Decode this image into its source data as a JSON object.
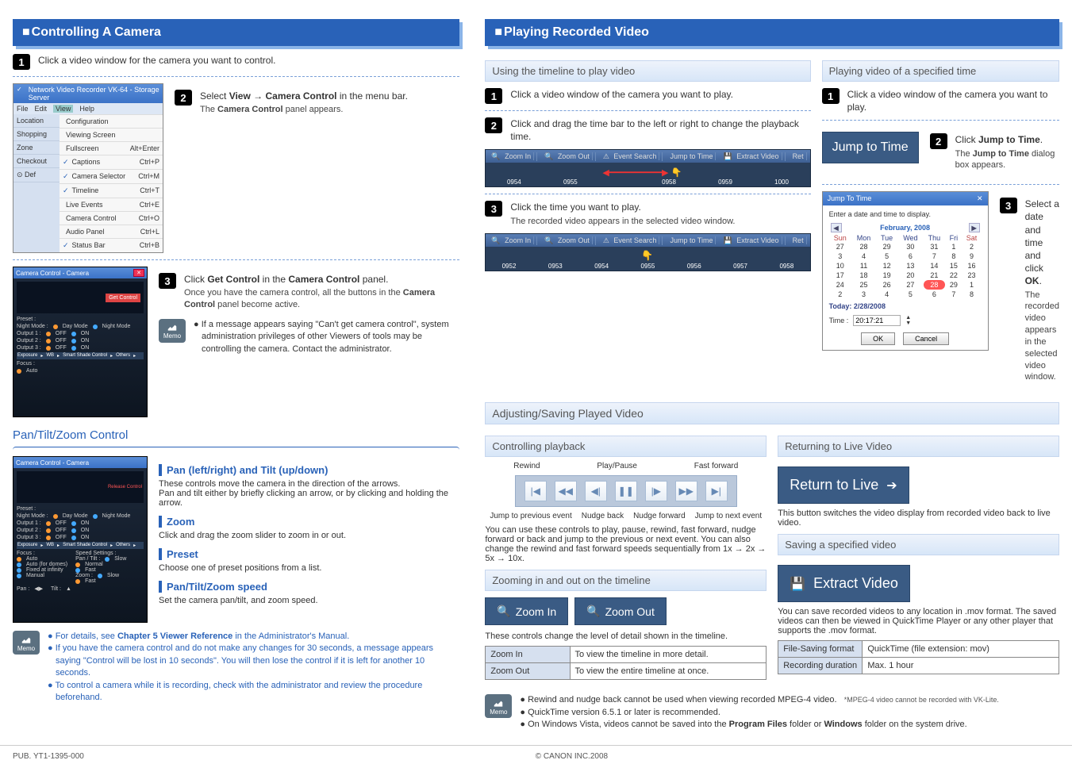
{
  "left": {
    "heading": "Controlling A Camera",
    "step1": "Click a video window for the camera you want to control.",
    "step2_a": "Select ",
    "step2_b": "View",
    "step2_c": " → ",
    "step2_d": "Camera Control",
    "step2_e": " in the menu bar.",
    "step2_sub_a": "The ",
    "step2_sub_b": "Camera Control",
    "step2_sub_c": " panel appears.",
    "step3_a": "Click ",
    "step3_b": "Get Control",
    "step3_c": " in the ",
    "step3_d": "Camera Control",
    "step3_e": " panel.",
    "step3_sub_a": "Once you have the camera control, all the buttons in the ",
    "step3_sub_b": "Camera Control",
    "step3_sub_c": " panel become active.",
    "menu": {
      "title": "Network Video Recorder VK-64 - Storage Server",
      "bar": [
        "File",
        "Edit",
        "View",
        "Help"
      ],
      "side": [
        "Location",
        "Shopping",
        "Zone",
        "Checkout",
        "Def"
      ],
      "items": [
        {
          "chk": "",
          "label": "Configuration",
          "sc": ""
        },
        {
          "chk": "",
          "label": "Viewing Screen",
          "sc": ""
        },
        {
          "chk": "",
          "label": "Fullscreen",
          "sc": "Alt+Enter"
        },
        {
          "chk": "✓",
          "label": "Captions",
          "sc": "Ctrl+P"
        },
        {
          "chk": "✓",
          "label": "Camera Selector",
          "sc": "Ctrl+M"
        },
        {
          "chk": "✓",
          "label": "Timeline",
          "sc": "Ctrl+T"
        },
        {
          "chk": "",
          "label": "Live Events",
          "sc": "Ctrl+E"
        },
        {
          "chk": "",
          "label": "Camera Control",
          "sc": "Ctrl+O"
        },
        {
          "chk": "",
          "label": "Audio Panel",
          "sc": "Ctrl+L"
        },
        {
          "chk": "✓",
          "label": "Status Bar",
          "sc": "Ctrl+B"
        }
      ]
    },
    "camctrl_title": "Camera Control - Camera",
    "camctrl_btn": "Get Control",
    "camctrl_labels": {
      "preset": "Preset :",
      "night": "Night Mode :",
      "night_day": "Day Mode",
      "night_night": "Night Mode",
      "out1": "Output 1 :",
      "out2": "Output 2 :",
      "out3": "Output 3 :",
      "off": "OFF",
      "on": "ON",
      "exposure": "Exposure",
      "wb": "WB",
      "smartshade": "Smart Shade Control",
      "others": "Others",
      "focus": "Focus :",
      "f_auto": "Auto",
      "f_autod": "Auto (for domes)",
      "f_fixed": "Fixed at infinity",
      "f_man": "Manual",
      "speed": "Speed Settings :",
      "pantilt": "Pan / Tilt :",
      "slow": "Slow",
      "normal": "Normal",
      "fast": "Fast",
      "zoom": "Zoom :",
      "pan": "Pan :",
      "tilt": "Tilt :"
    },
    "memo1": "If a message appears saying \"Can't get camera control\", system administration privileges of other Viewers of tools may be controlling the camera. Contact the administrator.",
    "ptz_heading": "Pan/Tilt/Zoom Control",
    "pan_h": "Pan (left/right) and Tilt (up/down)",
    "pan_t1": "These controls move the camera in the direction of the arrows.",
    "pan_t2": "Pan and tilt either by briefly clicking an arrow, or by clicking and holding the arrow.",
    "zoom_h": "Zoom",
    "zoom_t": "Click and drag the zoom slider to zoom in or out.",
    "preset_h": "Preset",
    "preset_t": "Choose one of preset positions from a list.",
    "speed_h": "Pan/Tilt/Zoom speed",
    "speed_t": "Set the camera pan/tilt, and zoom speed.",
    "memo2_a_pre": "For details, see ",
    "memo2_a_bold": "Chapter 5 Viewer Reference",
    "memo2_a_post": " in the Administrator's Manual.",
    "memo2_b": "If you have the camera control and do not make any changes for 30 seconds, a message appears saying \"Control will be lost in 10 seconds\". You will then lose the control if it is left for another 10 seconds.",
    "memo2_c": "To control a camera while it is recording, check with the administrator and review the procedure beforehand."
  },
  "right": {
    "heading": "Playing Recorded Video",
    "sub1": "Using the timeline to play video",
    "sub2": "Playing video of a specified time",
    "sub3": "Adjusting/Saving Played Video",
    "sub4": "Controlling playback",
    "sub5": "Zooming in and out on the timeline",
    "sub6": "Returning to Live Video",
    "sub7": "Saving a specified video",
    "astep1": "Click a video window of the camera you want to play.",
    "astep2": "Click and drag the time bar to the left or right to change the playback time.",
    "astep3": "Click the time you want to play.",
    "astep3_sub": "The recorded video appears in the selected video window.",
    "b_step1": "Click a video window of the camera you want to play.",
    "b_step2_a": "Click ",
    "b_step2_b": "Jump to Time",
    "b_step2_c": ".",
    "b_step2_sub_a": "The ",
    "b_step2_sub_b": "Jump to Time",
    "b_step2_sub_c": " dialog box appears.",
    "b_step3_a": "Select a date and time and click ",
    "b_step3_b": "OK",
    "b_step3_c": ".",
    "b_step3_sub": "The recorded video appears in the selected video window.",
    "tl_btns": [
      "Zoom In",
      "Zoom Out",
      "Event Search",
      "Jump to Time",
      "Extract Video",
      "Ret"
    ],
    "tl1_ticks": [
      "0954",
      "0955",
      "0958",
      "0959",
      "1000"
    ],
    "tl2_ticks": [
      "0952",
      "0953",
      "0954",
      "0955",
      "0956",
      "0957",
      "0958"
    ],
    "jump_btn": "Jump to Time",
    "cal": {
      "title": "Jump To Time",
      "instr": "Enter a date and time to display.",
      "month": "February, 2008",
      "dow": [
        "Sun",
        "Mon",
        "Tue",
        "Wed",
        "Thu",
        "Fri",
        "Sat"
      ],
      "rows": [
        [
          "27",
          "28",
          "29",
          "30",
          "31",
          "1",
          "2"
        ],
        [
          "3",
          "4",
          "5",
          "6",
          "7",
          "8",
          "9"
        ],
        [
          "10",
          "11",
          "12",
          "13",
          "14",
          "15",
          "16"
        ],
        [
          "17",
          "18",
          "19",
          "20",
          "21",
          "22",
          "23"
        ],
        [
          "24",
          "25",
          "26",
          "27",
          "28",
          "29",
          "1"
        ],
        [
          "2",
          "3",
          "4",
          "5",
          "6",
          "7",
          "8"
        ]
      ],
      "today_cell": "28",
      "today": "Today: 2/28/2008",
      "time_l": "Time :",
      "time_v": "20:17:21",
      "ok": "OK",
      "cancel": "Cancel"
    },
    "pb_labels": {
      "rw": "Rewind",
      "pp": "Play/Pause",
      "ff": "Fast forward",
      "jp": "Jump to previous event",
      "nb": "Nudge back",
      "nf": "Nudge forward",
      "jn": "Jump to next event"
    },
    "pb_desc": "You can use these controls to play, pause, rewind, fast forward, nudge forward or back and jump to the previous or next event. You can also change the rewind and fast forward speeds sequentially from 1x → 2x → 5x → 10x.",
    "zoom_in": "Zoom In",
    "zoom_out": "Zoom Out",
    "zoom_desc": "These controls change the level of detail shown in the timeline.",
    "zoom_tbl_in_l": "Zoom In",
    "zoom_tbl_in_v": "To view the timeline in more detail.",
    "zoom_tbl_out_l": "Zoom Out",
    "zoom_tbl_out_v": "To view the entire timeline at once.",
    "return_btn": "Return to Live",
    "return_desc": "This button switches the video display from recorded video back to live video.",
    "extract_btn": "Extract Video",
    "extract_desc": "You can save recorded videos to any location in .mov format. The saved videos can then be viewed in QuickTime Player or any other player that supports the .mov format.",
    "fmt_l": "File-Saving format",
    "fmt_v": "QuickTime (file extension: mov)",
    "dur_l": "Recording duration",
    "dur_v": "Max. 1 hour",
    "memoR_a_main": "Rewind and nudge back cannot be used when viewing recorded MPEG-4 video.",
    "memoR_a_note": "*MPEG-4 video cannot be recorded with VK-Lite.",
    "memoR_b": "QuickTime version 6.5.1 or later is recommended.",
    "memoR_c_a": "On Windows Vista, videos cannot be saved into the ",
    "memoR_c_b": "Program Files",
    "memoR_c_c": " folder or ",
    "memoR_c_d": "Windows",
    "memoR_c_e": " folder on the system drive."
  },
  "footer": {
    "pub": "PUB. YT1-1395-000",
    "copy": "© CANON INC.2008"
  },
  "memo_label": "Memo"
}
